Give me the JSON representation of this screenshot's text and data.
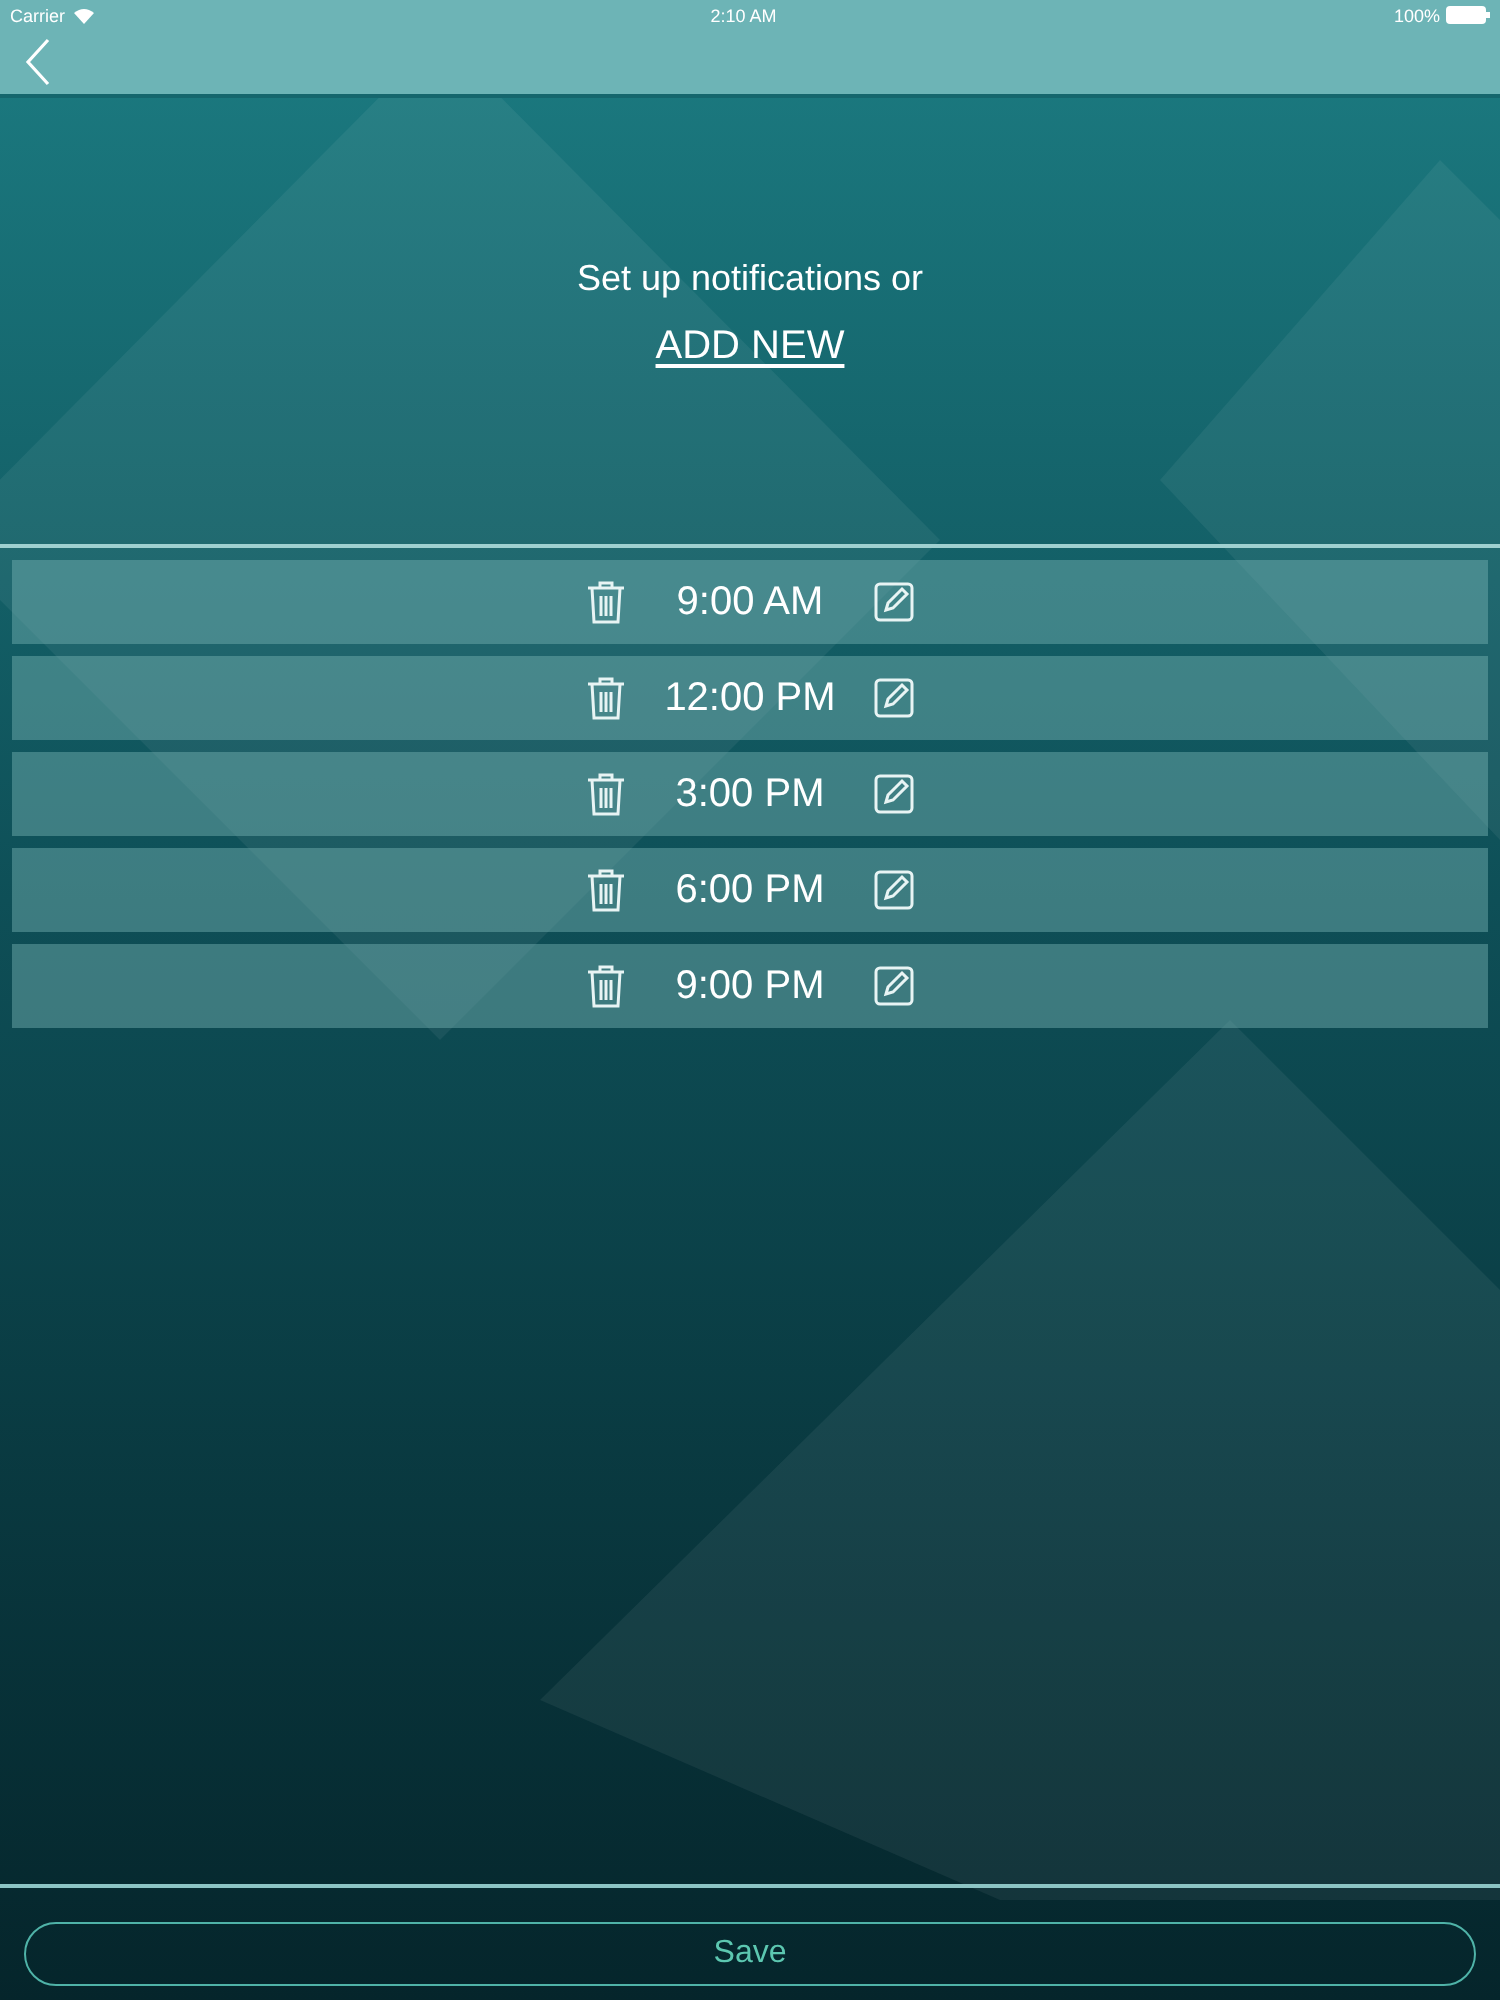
{
  "status_bar": {
    "carrier": "Carrier",
    "time": "2:10 AM",
    "battery": "100%"
  },
  "intro": {
    "text": "Set up notifications or",
    "link": "ADD NEW"
  },
  "notifications": [
    {
      "time": "9:00 AM"
    },
    {
      "time": "12:00 PM"
    },
    {
      "time": "3:00 PM"
    },
    {
      "time": "6:00 PM"
    },
    {
      "time": "9:00 PM"
    }
  ],
  "save_button": "Save"
}
